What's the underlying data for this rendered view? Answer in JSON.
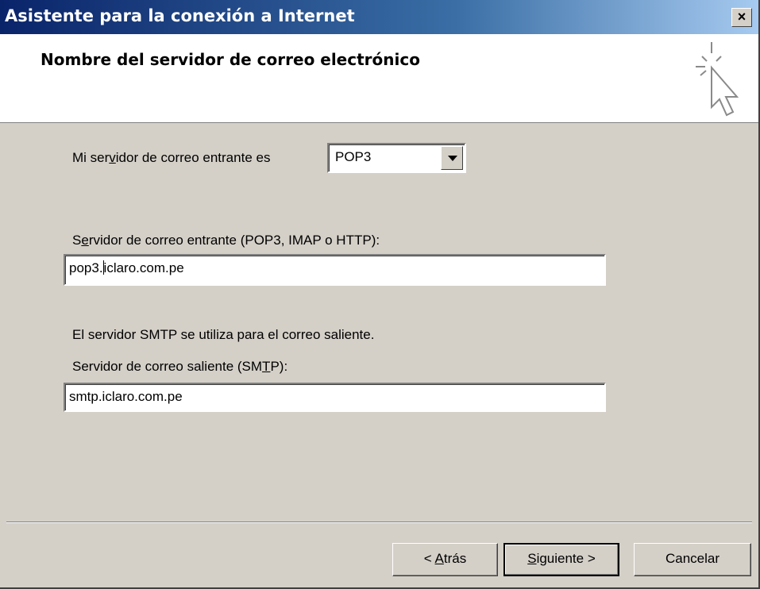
{
  "window": {
    "title": "Asistente para la conexión a Internet",
    "close_glyph": "×"
  },
  "header": {
    "title": "Nombre del servidor de correo electrónico",
    "icon": "sparkle-cursor-icon"
  },
  "incoming_type": {
    "label_pre": "Mi ser",
    "label_accel": "v",
    "label_post": "idor de correo entrante es",
    "selected": "POP3"
  },
  "incoming_server": {
    "label_pre": "S",
    "label_accel": "e",
    "label_post": "rvidor de correo entrante (POP3, IMAP o HTTP):",
    "value_before_caret": "pop3.",
    "value_after_caret": "iclaro.com.pe"
  },
  "smtp_note": "El servidor SMTP se utiliza para el correo saliente.",
  "outgoing_server": {
    "label_pre": "Servidor de correo saliente (SM",
    "label_accel": "T",
    "label_post": "P):",
    "value": "smtp.iclaro.com.pe"
  },
  "buttons": {
    "back_pre": "< ",
    "back_accel": "A",
    "back_post": "trás",
    "next_accel": "S",
    "next_post": "iguiente >",
    "cancel": "Cancelar"
  }
}
